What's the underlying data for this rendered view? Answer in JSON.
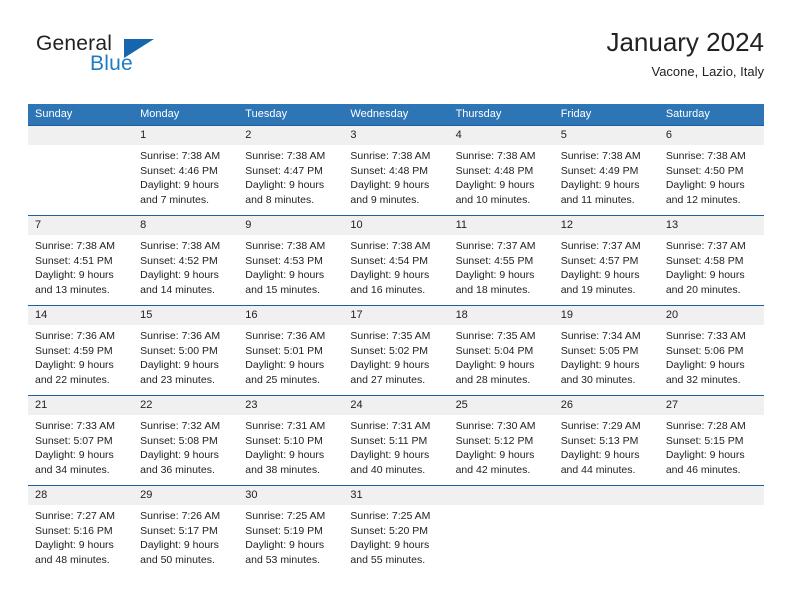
{
  "brand": {
    "name_top": "General",
    "name_bottom": "Blue",
    "logo_icon": "triangle-logo-icon",
    "color_dark": "#231f20",
    "color_blue": "#1d7cc4",
    "color_triangle": "#1566ad"
  },
  "header": {
    "title": "January 2024",
    "location": "Vacone, Lazio, Italy"
  },
  "theme": {
    "header_blue": "#2e75b6",
    "rule_blue": "#1f5fa0",
    "daynum_band": "#f0f0f0",
    "text": "#222222"
  },
  "weekdays": [
    "Sunday",
    "Monday",
    "Tuesday",
    "Wednesday",
    "Thursday",
    "Friday",
    "Saturday"
  ],
  "weeks": [
    {
      "days": [
        {
          "num": "",
          "sunrise": "",
          "sunset": "",
          "daylight_1": "",
          "daylight_2": ""
        },
        {
          "num": "1",
          "sunrise": "Sunrise: 7:38 AM",
          "sunset": "Sunset: 4:46 PM",
          "daylight_1": "Daylight: 9 hours",
          "daylight_2": "and 7 minutes."
        },
        {
          "num": "2",
          "sunrise": "Sunrise: 7:38 AM",
          "sunset": "Sunset: 4:47 PM",
          "daylight_1": "Daylight: 9 hours",
          "daylight_2": "and 8 minutes."
        },
        {
          "num": "3",
          "sunrise": "Sunrise: 7:38 AM",
          "sunset": "Sunset: 4:48 PM",
          "daylight_1": "Daylight: 9 hours",
          "daylight_2": "and 9 minutes."
        },
        {
          "num": "4",
          "sunrise": "Sunrise: 7:38 AM",
          "sunset": "Sunset: 4:48 PM",
          "daylight_1": "Daylight: 9 hours",
          "daylight_2": "and 10 minutes."
        },
        {
          "num": "5",
          "sunrise": "Sunrise: 7:38 AM",
          "sunset": "Sunset: 4:49 PM",
          "daylight_1": "Daylight: 9 hours",
          "daylight_2": "and 11 minutes."
        },
        {
          "num": "6",
          "sunrise": "Sunrise: 7:38 AM",
          "sunset": "Sunset: 4:50 PM",
          "daylight_1": "Daylight: 9 hours",
          "daylight_2": "and 12 minutes."
        }
      ]
    },
    {
      "days": [
        {
          "num": "7",
          "sunrise": "Sunrise: 7:38 AM",
          "sunset": "Sunset: 4:51 PM",
          "daylight_1": "Daylight: 9 hours",
          "daylight_2": "and 13 minutes."
        },
        {
          "num": "8",
          "sunrise": "Sunrise: 7:38 AM",
          "sunset": "Sunset: 4:52 PM",
          "daylight_1": "Daylight: 9 hours",
          "daylight_2": "and 14 minutes."
        },
        {
          "num": "9",
          "sunrise": "Sunrise: 7:38 AM",
          "sunset": "Sunset: 4:53 PM",
          "daylight_1": "Daylight: 9 hours",
          "daylight_2": "and 15 minutes."
        },
        {
          "num": "10",
          "sunrise": "Sunrise: 7:38 AM",
          "sunset": "Sunset: 4:54 PM",
          "daylight_1": "Daylight: 9 hours",
          "daylight_2": "and 16 minutes."
        },
        {
          "num": "11",
          "sunrise": "Sunrise: 7:37 AM",
          "sunset": "Sunset: 4:55 PM",
          "daylight_1": "Daylight: 9 hours",
          "daylight_2": "and 18 minutes."
        },
        {
          "num": "12",
          "sunrise": "Sunrise: 7:37 AM",
          "sunset": "Sunset: 4:57 PM",
          "daylight_1": "Daylight: 9 hours",
          "daylight_2": "and 19 minutes."
        },
        {
          "num": "13",
          "sunrise": "Sunrise: 7:37 AM",
          "sunset": "Sunset: 4:58 PM",
          "daylight_1": "Daylight: 9 hours",
          "daylight_2": "and 20 minutes."
        }
      ]
    },
    {
      "days": [
        {
          "num": "14",
          "sunrise": "Sunrise: 7:36 AM",
          "sunset": "Sunset: 4:59 PM",
          "daylight_1": "Daylight: 9 hours",
          "daylight_2": "and 22 minutes."
        },
        {
          "num": "15",
          "sunrise": "Sunrise: 7:36 AM",
          "sunset": "Sunset: 5:00 PM",
          "daylight_1": "Daylight: 9 hours",
          "daylight_2": "and 23 minutes."
        },
        {
          "num": "16",
          "sunrise": "Sunrise: 7:36 AM",
          "sunset": "Sunset: 5:01 PM",
          "daylight_1": "Daylight: 9 hours",
          "daylight_2": "and 25 minutes."
        },
        {
          "num": "17",
          "sunrise": "Sunrise: 7:35 AM",
          "sunset": "Sunset: 5:02 PM",
          "daylight_1": "Daylight: 9 hours",
          "daylight_2": "and 27 minutes."
        },
        {
          "num": "18",
          "sunrise": "Sunrise: 7:35 AM",
          "sunset": "Sunset: 5:04 PM",
          "daylight_1": "Daylight: 9 hours",
          "daylight_2": "and 28 minutes."
        },
        {
          "num": "19",
          "sunrise": "Sunrise: 7:34 AM",
          "sunset": "Sunset: 5:05 PM",
          "daylight_1": "Daylight: 9 hours",
          "daylight_2": "and 30 minutes."
        },
        {
          "num": "20",
          "sunrise": "Sunrise: 7:33 AM",
          "sunset": "Sunset: 5:06 PM",
          "daylight_1": "Daylight: 9 hours",
          "daylight_2": "and 32 minutes."
        }
      ]
    },
    {
      "days": [
        {
          "num": "21",
          "sunrise": "Sunrise: 7:33 AM",
          "sunset": "Sunset: 5:07 PM",
          "daylight_1": "Daylight: 9 hours",
          "daylight_2": "and 34 minutes."
        },
        {
          "num": "22",
          "sunrise": "Sunrise: 7:32 AM",
          "sunset": "Sunset: 5:08 PM",
          "daylight_1": "Daylight: 9 hours",
          "daylight_2": "and 36 minutes."
        },
        {
          "num": "23",
          "sunrise": "Sunrise: 7:31 AM",
          "sunset": "Sunset: 5:10 PM",
          "daylight_1": "Daylight: 9 hours",
          "daylight_2": "and 38 minutes."
        },
        {
          "num": "24",
          "sunrise": "Sunrise: 7:31 AM",
          "sunset": "Sunset: 5:11 PM",
          "daylight_1": "Daylight: 9 hours",
          "daylight_2": "and 40 minutes."
        },
        {
          "num": "25",
          "sunrise": "Sunrise: 7:30 AM",
          "sunset": "Sunset: 5:12 PM",
          "daylight_1": "Daylight: 9 hours",
          "daylight_2": "and 42 minutes."
        },
        {
          "num": "26",
          "sunrise": "Sunrise: 7:29 AM",
          "sunset": "Sunset: 5:13 PM",
          "daylight_1": "Daylight: 9 hours",
          "daylight_2": "and 44 minutes."
        },
        {
          "num": "27",
          "sunrise": "Sunrise: 7:28 AM",
          "sunset": "Sunset: 5:15 PM",
          "daylight_1": "Daylight: 9 hours",
          "daylight_2": "and 46 minutes."
        }
      ]
    },
    {
      "days": [
        {
          "num": "28",
          "sunrise": "Sunrise: 7:27 AM",
          "sunset": "Sunset: 5:16 PM",
          "daylight_1": "Daylight: 9 hours",
          "daylight_2": "and 48 minutes."
        },
        {
          "num": "29",
          "sunrise": "Sunrise: 7:26 AM",
          "sunset": "Sunset: 5:17 PM",
          "daylight_1": "Daylight: 9 hours",
          "daylight_2": "and 50 minutes."
        },
        {
          "num": "30",
          "sunrise": "Sunrise: 7:25 AM",
          "sunset": "Sunset: 5:19 PM",
          "daylight_1": "Daylight: 9 hours",
          "daylight_2": "and 53 minutes."
        },
        {
          "num": "31",
          "sunrise": "Sunrise: 7:25 AM",
          "sunset": "Sunset: 5:20 PM",
          "daylight_1": "Daylight: 9 hours",
          "daylight_2": "and 55 minutes."
        },
        {
          "num": "",
          "sunrise": "",
          "sunset": "",
          "daylight_1": "",
          "daylight_2": ""
        },
        {
          "num": "",
          "sunrise": "",
          "sunset": "",
          "daylight_1": "",
          "daylight_2": ""
        },
        {
          "num": "",
          "sunrise": "",
          "sunset": "",
          "daylight_1": "",
          "daylight_2": ""
        }
      ]
    }
  ]
}
